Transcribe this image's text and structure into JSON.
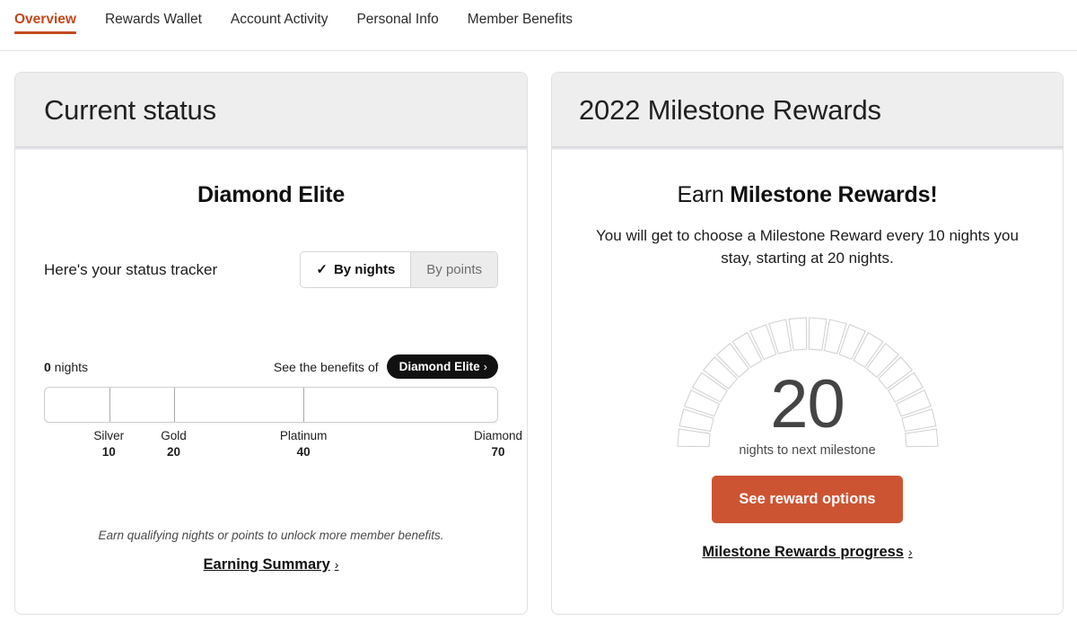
{
  "tabs": [
    {
      "label": "Overview",
      "active": true
    },
    {
      "label": "Rewards Wallet",
      "active": false
    },
    {
      "label": "Account Activity",
      "active": false
    },
    {
      "label": "Personal Info",
      "active": false
    },
    {
      "label": "Member Benefits",
      "active": false
    }
  ],
  "colors": {
    "accent": "#c2491d",
    "cta": "#cd5433",
    "pill_bg": "#111111",
    "header_bg": "#eeeeee"
  },
  "current_status": {
    "header_title": "Current status",
    "tier": "Diamond Elite",
    "tracker_label": "Here's your status tracker",
    "toggle": {
      "check_icon": "✓",
      "by_nights": "By nights",
      "by_points": "By points",
      "selected": "By nights"
    },
    "nights_value": "0",
    "nights_unit": " nights",
    "benefits_prefix": "See the benefits of",
    "benefits_pill": "Diamond Elite",
    "pill_chevron": "›",
    "tiers": [
      {
        "name": "Silver",
        "value": "10"
      },
      {
        "name": "Gold",
        "value": "20"
      },
      {
        "name": "Platinum",
        "value": "40"
      },
      {
        "name": "Diamond",
        "value": "70"
      }
    ],
    "footnote": "Earn qualifying nights or points to unlock more member benefits.",
    "link_label": "Earning Summary",
    "link_chevron": "›"
  },
  "milestone_rewards": {
    "header_title": "2022 Milestone Rewards",
    "headline_prefix": "Earn ",
    "headline_strong": "Milestone Rewards!",
    "description": "You will get to choose a Milestone Reward every 10 nights you stay, starting at 20 nights.",
    "gauge": {
      "number": "20",
      "caption": "nights to next milestone",
      "segments_total": 20,
      "segments_filled": 0
    },
    "cta_label": "See reward options",
    "link_label": "Milestone Rewards progress",
    "link_chevron": "›"
  }
}
